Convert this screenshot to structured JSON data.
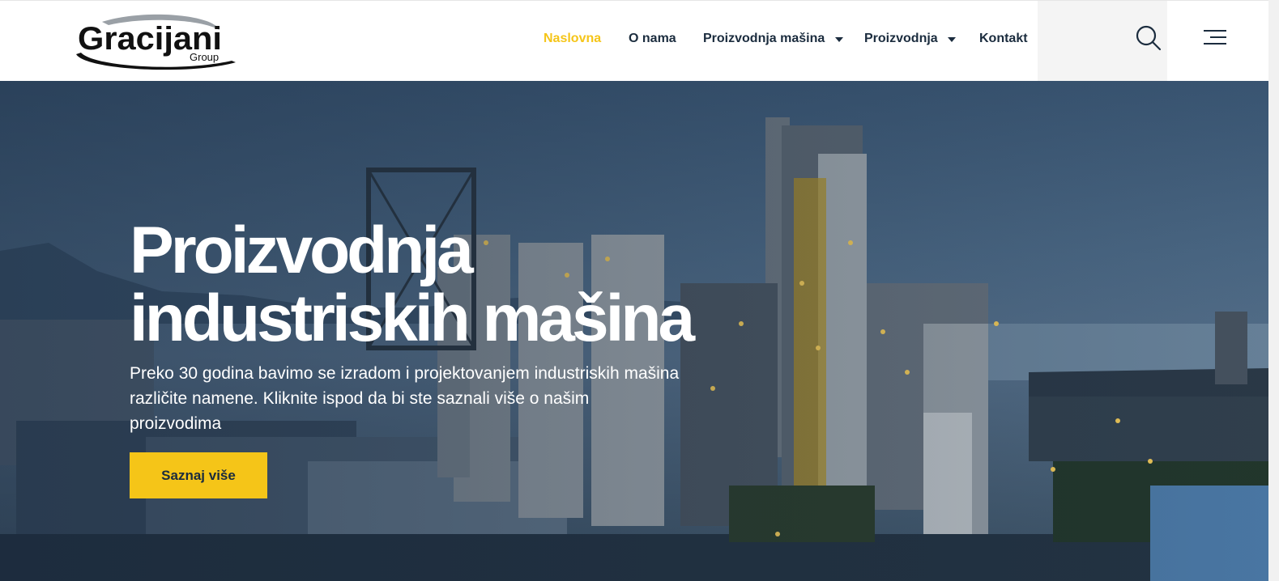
{
  "brand": {
    "logo_text": "Gracijani",
    "logo_subtext": "Group"
  },
  "nav": {
    "items": [
      {
        "label": "Naslovna",
        "active": true
      },
      {
        "label": "O nama",
        "active": false
      },
      {
        "label": "Proizvodnja mašina",
        "active": false,
        "has_dropdown": true
      },
      {
        "label": "Proizvodnja",
        "active": false,
        "has_dropdown": true
      },
      {
        "label": "Kontakt",
        "active": false
      }
    ],
    "search_icon": "search-icon",
    "menu_icon": "hamburger-menu-icon"
  },
  "hero": {
    "title_line1": "Proizvodnja",
    "title_line2": "industriskih mašina",
    "description": "Preko 30 godina bavimo se izradom i projektovanjem industriskih mašina različite namene. Kliknite ispod da bi ste saznali više o našim proizvodima",
    "button_label": "Saznaj više",
    "background_image": "industrial-plant-at-dusk"
  },
  "colors": {
    "accent": "#f5c518",
    "nav_text": "#1b2c3e",
    "hero_text": "#ffffff"
  }
}
